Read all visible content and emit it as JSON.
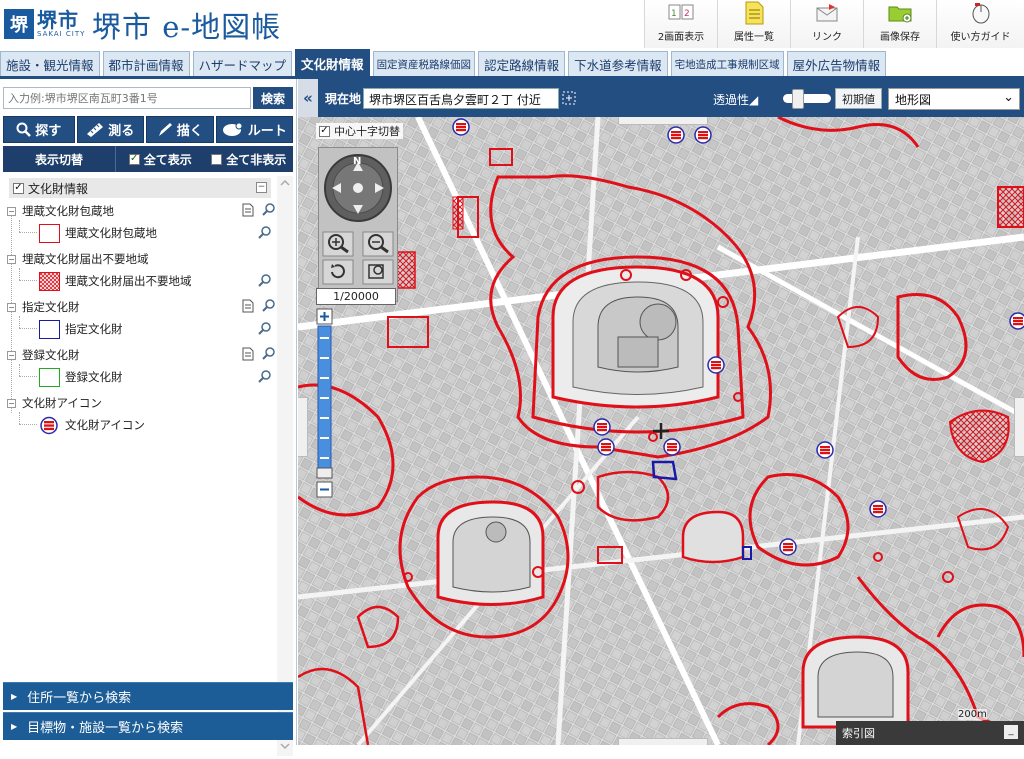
{
  "header": {
    "logo_mark": "堺",
    "logo_jp": "堺市",
    "logo_en": "SAKAI CITY",
    "app_title": "堺市 e-地図帳"
  },
  "tools": [
    {
      "label": "2画面表示",
      "icon": "dual-screen-icon"
    },
    {
      "label": "属性一覧",
      "icon": "document-list-icon"
    },
    {
      "label": "リンク",
      "icon": "link-mail-icon"
    },
    {
      "label": "画像保存",
      "icon": "save-folder-icon"
    },
    {
      "label": "使い方ガイド",
      "icon": "mouse-guide-icon"
    }
  ],
  "tabs": [
    {
      "label": "施設・観光情報",
      "active": false,
      "small": false
    },
    {
      "label": "都市計画情報",
      "active": false,
      "small": false
    },
    {
      "label": "ハザードマップ",
      "active": false,
      "small": false
    },
    {
      "label": "文化財情報",
      "active": true,
      "small": false
    },
    {
      "label": "固定資産税路線価図",
      "active": false,
      "small": true
    },
    {
      "label": "認定路線情報",
      "active": false,
      "small": false
    },
    {
      "label": "下水道参考情報",
      "active": false,
      "small": false
    },
    {
      "label": "宅地造成工事規制区域",
      "active": false,
      "small": true
    },
    {
      "label": "屋外広告物情報",
      "active": false,
      "small": false
    }
  ],
  "search": {
    "placeholder": "入力例:堺市堺区南瓦町3番1号",
    "button": "検索"
  },
  "functions": [
    {
      "label": "探す",
      "icon": "magnifier-icon"
    },
    {
      "label": "測る",
      "icon": "ruler-icon"
    },
    {
      "label": "描く",
      "icon": "pen-icon"
    },
    {
      "label": "ルート",
      "icon": "route-icon"
    }
  ],
  "display": {
    "title": "表示切替",
    "show_all": "全て表示",
    "hide_all": "全て非表示"
  },
  "tree": {
    "root": "文化財情報",
    "groups": [
      {
        "label": "埋蔵文化財包蔵地",
        "child": "埋蔵文化財包蔵地",
        "swatch": "red-outline",
        "has_doc": true
      },
      {
        "label": "埋蔵文化財届出不要地域",
        "child": "埋蔵文化財届出不要地域",
        "swatch": "red-hatch",
        "has_doc": false
      },
      {
        "label": "指定文化財",
        "child": "指定文化財",
        "swatch": "blue-outline",
        "has_doc": true
      },
      {
        "label": "登録文化財",
        "child": "登録文化財",
        "swatch": "green-outline",
        "has_doc": true
      },
      {
        "label": "文化財アイコン",
        "child": "文化財アイコン",
        "swatch": "kofun-icon",
        "has_doc": false
      }
    ]
  },
  "bottom_links": [
    {
      "label": "住所一覧から検索"
    },
    {
      "label": "目標物・施設一覧から検索"
    }
  ],
  "map_toolbar": {
    "collapse": "«",
    "location_label": "現在地",
    "location_value": "堺市堺区百舌鳥夕雲町２丁 付近",
    "transparency_label": "透過性◢",
    "reset_button": "初期値",
    "map_type": "地形図"
  },
  "map": {
    "crosshair_toggle": "中心十字切替",
    "scale": "1/20000",
    "compass_label": "N",
    "index_map": "索引図",
    "index_minimize": "_",
    "scale_text": "200m",
    "colors": {
      "boundary": "#e0101a",
      "designated": "#1a1aa8",
      "registered": "#22aa22"
    }
  }
}
